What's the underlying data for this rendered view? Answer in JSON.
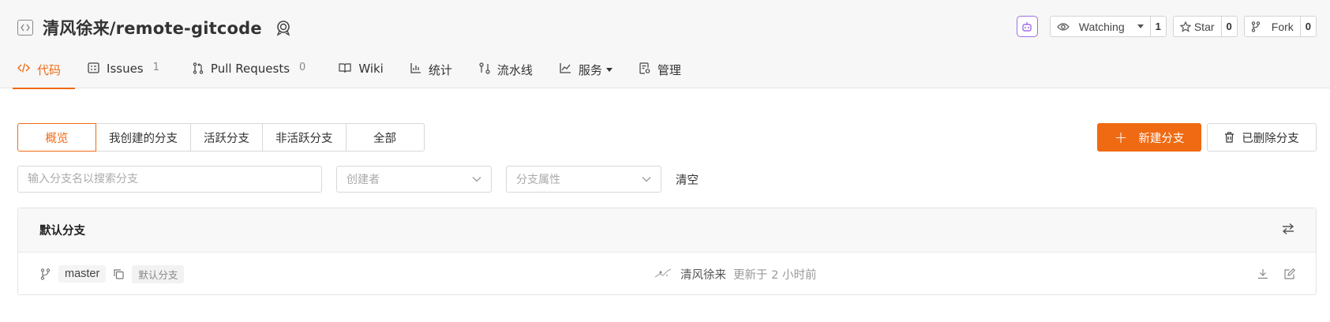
{
  "repo": {
    "title": "清风徐来/remote-gitcode"
  },
  "actions": {
    "watch_label": "Watching",
    "watch_count": "1",
    "star_label": "Star",
    "star_count": "0",
    "fork_label": "Fork",
    "fork_count": "0"
  },
  "tabs": [
    {
      "label": "代码",
      "count": ""
    },
    {
      "label": "Issues",
      "count": "1"
    },
    {
      "label": "Pull Requests",
      "count": "0"
    },
    {
      "label": "Wiki",
      "count": ""
    },
    {
      "label": "统计",
      "count": ""
    },
    {
      "label": "流水线",
      "count": ""
    },
    {
      "label": "服务",
      "count": ""
    },
    {
      "label": "管理",
      "count": ""
    }
  ],
  "filters": [
    "概览",
    "我创建的分支",
    "活跃分支",
    "非活跃分支",
    "全部"
  ],
  "buttons": {
    "new_branch": "新建分支",
    "deleted_branches": "已删除分支"
  },
  "search": {
    "placeholder": "输入分支名以搜索分支",
    "creator_placeholder": "创建者",
    "attr_placeholder": "分支属性",
    "clear": "清空"
  },
  "panel": {
    "title": "默认分支",
    "row": {
      "branch": "master",
      "tag": "默认分支",
      "author": "清风徐来",
      "updated": "更新于 2 小时前"
    }
  },
  "colors": {
    "accent": "#f06a13",
    "ai_border": "#a06ee8"
  }
}
